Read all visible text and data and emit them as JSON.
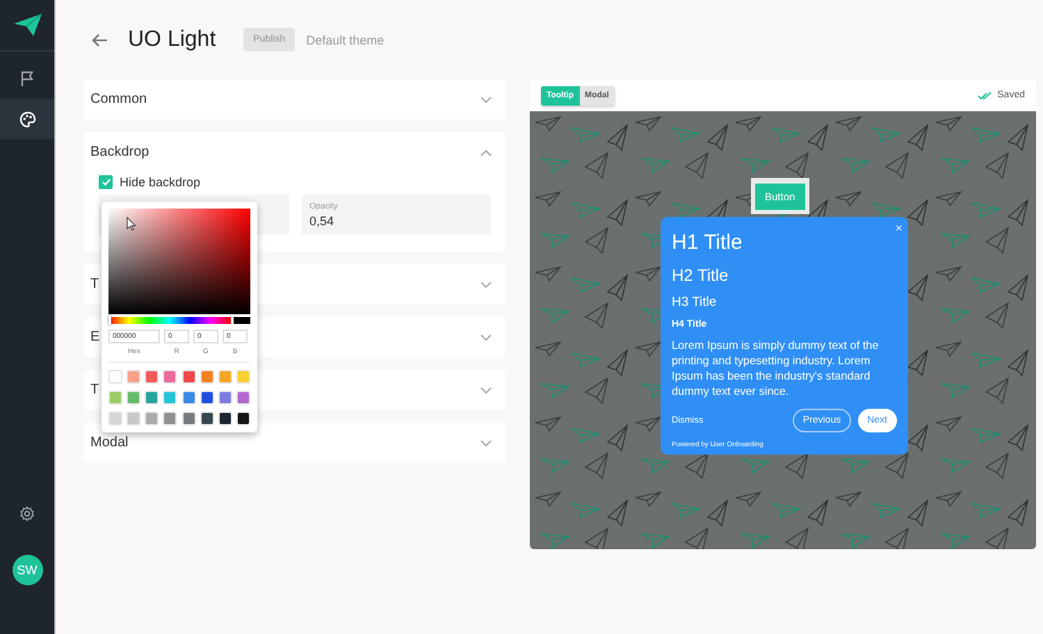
{
  "sidebar": {
    "items": [
      {
        "kind": "flag",
        "selected": false
      },
      {
        "kind": "palette",
        "selected": true
      }
    ],
    "avatar": "SW"
  },
  "header": {
    "title": "UO Light",
    "publish": {
      "label": "Publish",
      "disabled": true
    },
    "theme": "Default theme"
  },
  "sections": [
    {
      "title": "Common",
      "expanded": false
    },
    {
      "title": "Backdrop",
      "expanded": true,
      "checkbox": {
        "label": "Hide backdrop",
        "checked": true
      },
      "fields": [
        {
          "label": "Opacity",
          "value": "0,54"
        }
      ]
    },
    {
      "title": "T",
      "expanded": false
    },
    {
      "title": "E",
      "expanded": false
    },
    {
      "title": "T",
      "expanded": false
    },
    {
      "title": "Modal",
      "expanded": false
    }
  ],
  "color_picker": {
    "hue": {
      "level": 0
    },
    "inputs": [
      {
        "label": "Hex",
        "value": "000000"
      },
      {
        "label": "R",
        "value": "0"
      },
      {
        "label": "G",
        "value": "0"
      },
      {
        "label": "B",
        "value": "0"
      }
    ],
    "swatches": [
      {
        "color": "#ffffff"
      },
      {
        "color": "#f9a08a"
      },
      {
        "color": "#f05a5a"
      },
      {
        "color": "#ec6a9c"
      },
      {
        "color": "#f04848"
      },
      {
        "color": "#f58220"
      },
      {
        "color": "#f5a623"
      },
      {
        "color": "#f8d030"
      },
      {
        "color": "#9ccc65"
      },
      {
        "color": "#66bb6a"
      },
      {
        "color": "#26a69a"
      },
      {
        "color": "#26c6da"
      },
      {
        "color": "#3d8ae6"
      },
      {
        "color": "#1f4fe0"
      },
      {
        "color": "#7e7be0"
      },
      {
        "color": "#b368d0"
      },
      {
        "color": "#d6d6d6"
      },
      {
        "color": "#c8c8c8"
      },
      {
        "color": "#aaaaaa"
      },
      {
        "color": "#909090"
      },
      {
        "color": "#777b80"
      },
      {
        "color": "#37474f"
      },
      {
        "color": "#1f2530"
      },
      {
        "color": "#161616"
      }
    ]
  },
  "preview": {
    "tabs": [
      {
        "label": "Tooltip",
        "selected": true
      },
      {
        "label": "Modal",
        "selected": false
      }
    ],
    "status": "Saved",
    "target_button": "Button",
    "tooltip": {
      "h1": "H1 Title",
      "h2": "H2 Title",
      "h3": "H3 Title",
      "h4": "H4 Title",
      "close": "×",
      "body": "Lorem Ipsum is simply dummy text of the printing and typesetting industry. Lorem Ipsum has been the industry's standard dummy text ever since.",
      "dismiss": "Dismiss",
      "previous": "Previous",
      "next": "Next",
      "powered": "Powered by User Onboarding"
    }
  }
}
